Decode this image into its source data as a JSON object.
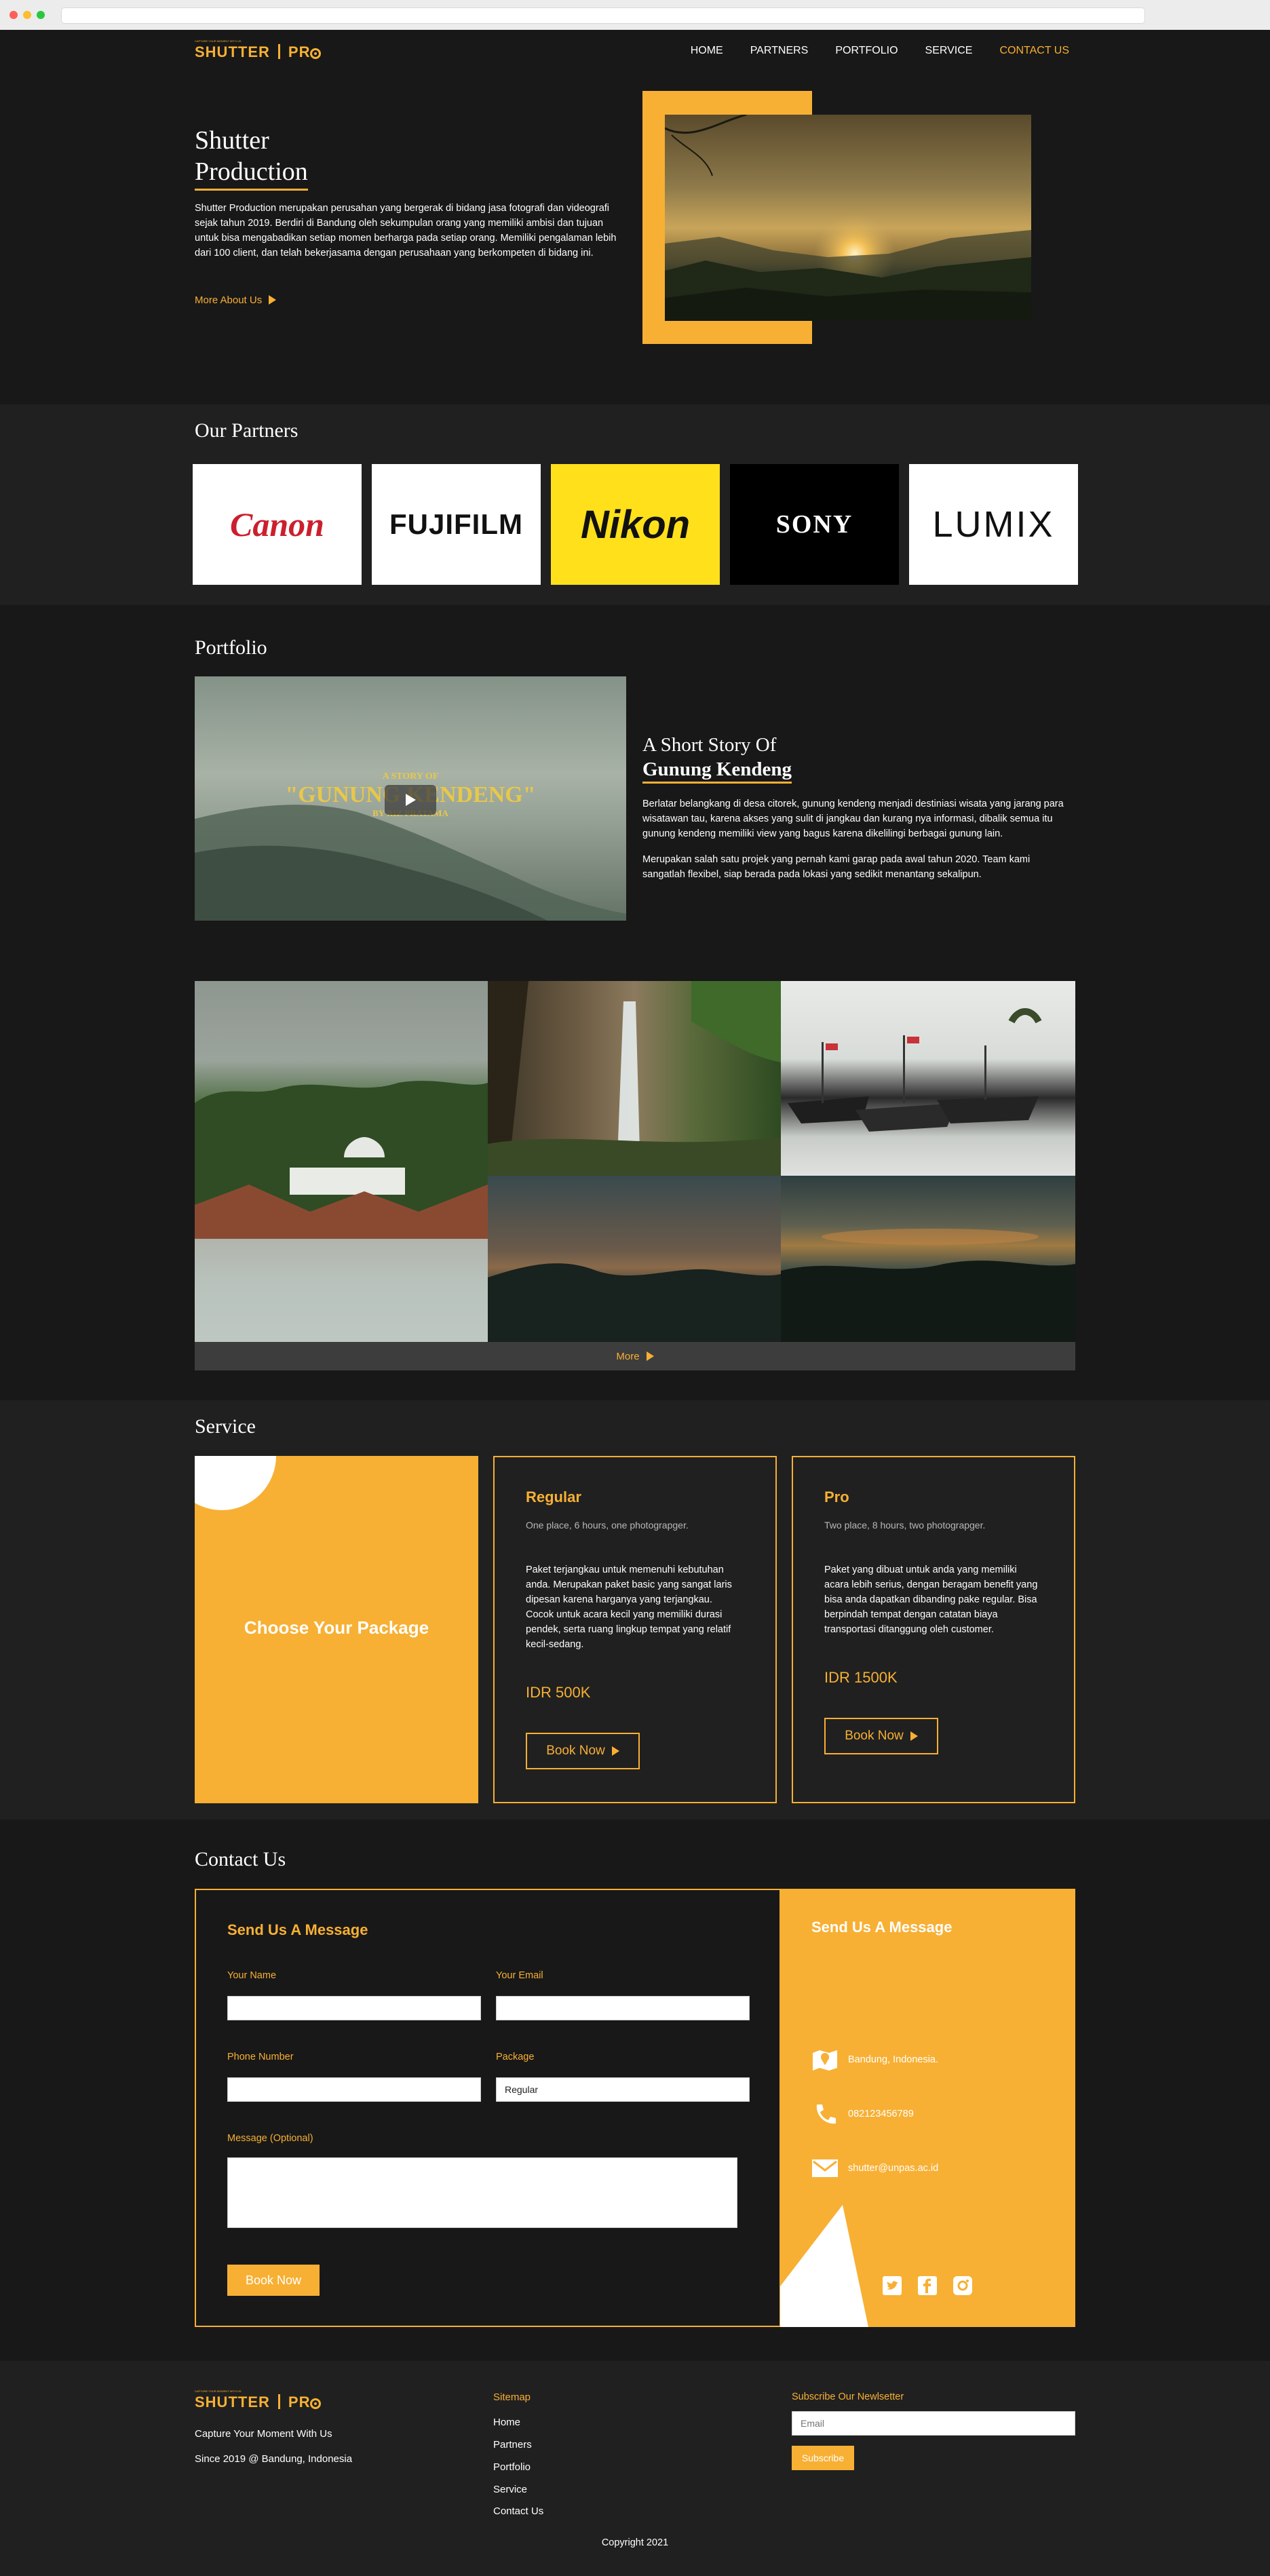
{
  "nav": {
    "logo_main": "SHUTTER",
    "logo_pro": "PR",
    "logo_tag": "CAPTURE YOUR MOMENT WITH US",
    "items": [
      {
        "label": "HOME",
        "active": false
      },
      {
        "label": "PARTNERS",
        "active": false
      },
      {
        "label": "PORTFOLIO",
        "active": false
      },
      {
        "label": "SERVICE",
        "active": false
      },
      {
        "label": "CONTACT US",
        "active": true
      }
    ]
  },
  "hero": {
    "title_line1": "Shutter",
    "title_line2": "Production",
    "text": "Shutter Production merupakan perusahan yang bergerak di bidang jasa fotografi dan videografi sejak tahun 2019. Berdiri di Bandung oleh sekumpulan orang yang memiliki ambisi dan tujuan untuk bisa mengabadikan setiap momen berharga pada setiap orang. Memiliki pengalaman lebih dari 100 client, dan telah bekerjasama dengan perusahaan yang berkompeten di bidang ini.",
    "more_label": "More About Us"
  },
  "partners": {
    "title": "Our Partners",
    "logos": [
      "Canon",
      "FUJIFILM",
      "Nikon",
      "SONY",
      "LUMIX"
    ]
  },
  "portfolio": {
    "title": "Portfolio",
    "video_small": "A STORY OF",
    "video_big": "\"GUNUNG KENDENG\"",
    "video_by": "BY RIZ PRATAMA",
    "story_line1": "A Short Story Of",
    "story_line2": "Gunung Kendeng",
    "para1": "Berlatar belangkang di desa citorek, gunung kendeng menjadi destiniasi wisata yang jarang para wisatawan tau, karena akses yang sulit di jangkau dan kurang nya informasi, dibalik semua itu gunung kendeng memiliki view yang bagus karena dikelilingi berbagai gunung lain.",
    "para2": "Merupakan salah satu projek yang pernah kami garap pada awal tahun 2020. Team kami sangatlah flexibel, siap berada pada lokasi yang sedikit menantang sekalipun.",
    "more_label": "More"
  },
  "service": {
    "title": "Service",
    "choose_label": "Choose Your Package",
    "packages": [
      {
        "name": "Regular",
        "subtitle": "One place, 6 hours, one photograpger.",
        "description": "Paket terjangkau untuk memenuhi kebutuhan anda. Merupakan paket basic yang sangat laris dipesan karena harganya yang terjangkau. Cocok untuk acara kecil yang memiliki durasi pendek, serta ruang lingkup tempat yang relatif kecil-sedang.",
        "price": "IDR 500K",
        "button": "Book Now"
      },
      {
        "name": "Pro",
        "subtitle": "Two place, 8 hours, two photograpger.",
        "description": "Paket yang dibuat untuk anda yang memiliki acara lebih serius, dengan beragam benefit yang bisa anda dapatkan dibanding pake regular. Bisa berpindah tempat dengan catatan biaya transportasi ditanggung oleh customer.",
        "price": "IDR 1500K",
        "button": "Book Now"
      }
    ]
  },
  "contact": {
    "title": "Contact Us",
    "form_title": "Send Us A Message",
    "labels": {
      "name": "Your Name",
      "email": "Your Email",
      "phone": "Phone Number",
      "package": "Package",
      "message": "Message (Optional)"
    },
    "package_value": "Regular",
    "submit": "Book Now",
    "info_title": "Send Us A Message",
    "address": "Bandung, Indonesia.",
    "phone": "082123456789",
    "email": "shutter@unpas.ac.id"
  },
  "footer": {
    "tagline": "Capture Your Moment With Us",
    "since": "Since 2019 @ Bandung, Indonesia",
    "sitemap_title": "Sitemap",
    "sitemap": [
      "Home",
      "Partners",
      "Portfolio",
      "Service",
      "Contact Us"
    ],
    "newsletter_title": "Subscribe Our Newlsetter",
    "email_placeholder": "Email",
    "subscribe": "Subscribe",
    "copyright": "Copyright 2021"
  },
  "colors": {
    "accent": "#f7b034",
    "dark": "#181818",
    "panel": "#202020"
  }
}
